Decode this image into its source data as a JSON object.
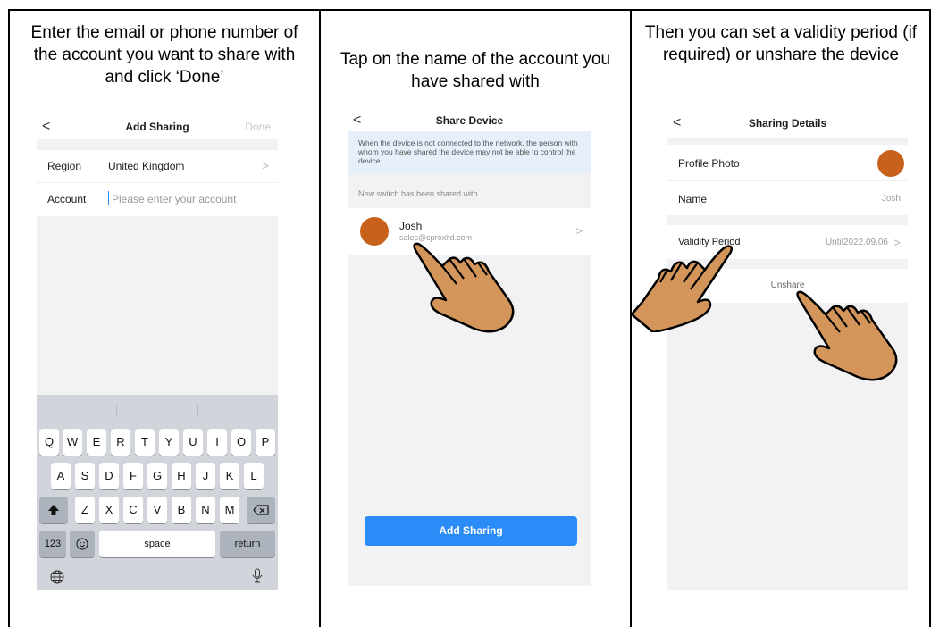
{
  "captions": [
    "Enter the email or phone number of the account you want to share with and click ‘Done’",
    "Tap on the name of the account you have shared with",
    "Then you can set a validity period (if required) or unshare the device"
  ],
  "screen1": {
    "back": "<",
    "title": "Add Sharing",
    "done": "Done",
    "region_label": "Region",
    "region_value": "United Kingdom",
    "region_chevron": ">",
    "account_label": "Account",
    "account_placeholder": "Please enter your account",
    "keyboard": {
      "row1": [
        "Q",
        "W",
        "E",
        "R",
        "T",
        "Y",
        "U",
        "I",
        "O",
        "P"
      ],
      "row2": [
        "A",
        "S",
        "D",
        "F",
        "G",
        "H",
        "J",
        "K",
        "L"
      ],
      "row3": [
        "Z",
        "X",
        "C",
        "V",
        "B",
        "N",
        "M"
      ],
      "numbers": "123",
      "space": "space",
      "return": "return"
    }
  },
  "screen2": {
    "back": "<",
    "title": "Share Device",
    "notice": "When the device is not connected to the network, the person with whom you have shared the device may not be able to control the device.",
    "section": "New switch has been shared with",
    "user_name": "Josh",
    "user_email": "sales@cproxltd.com",
    "chevron": ">",
    "add_button": "Add Sharing"
  },
  "screen3": {
    "back": "<",
    "title": "Sharing Details",
    "profile_photo": "Profile Photo",
    "name_label": "Name",
    "name_value": "Josh",
    "validity_label": "Validity Period",
    "validity_value": "Until2022.09.06",
    "chevron": ">",
    "unshare": "Unshare"
  },
  "colors": {
    "avatar": "#c8611b",
    "accent": "#2b8cf7",
    "hand": "#d4955a"
  }
}
